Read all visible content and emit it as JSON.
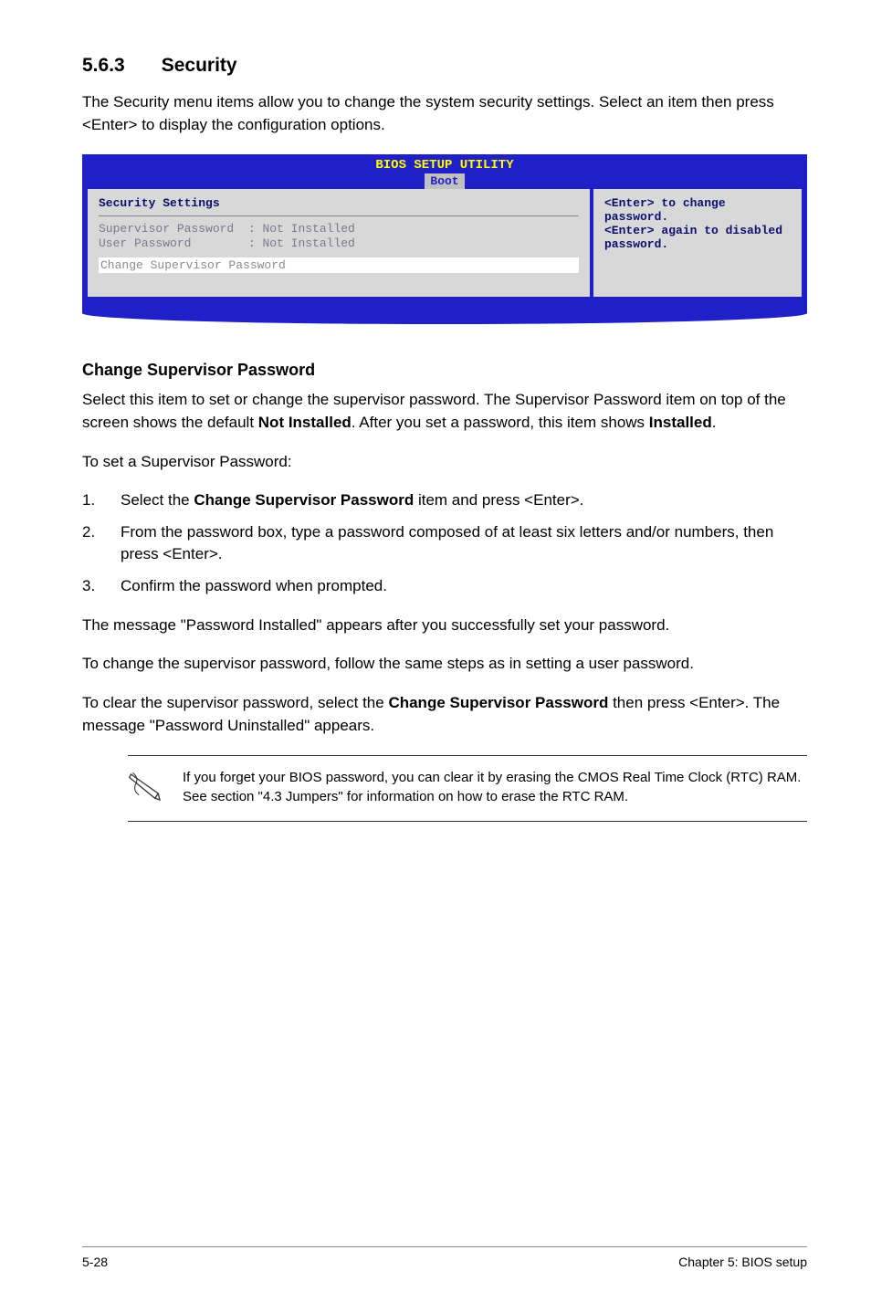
{
  "heading": {
    "number": "5.6.3",
    "title": "Security"
  },
  "intro": "The Security menu items allow you to change the system security settings. Select an item then press <Enter> to display the configuration options.",
  "bios": {
    "title": "BIOS SETUP UTILITY",
    "tab": "Boot",
    "left_heading": "Security Settings",
    "row1_label": "Supervisor Password",
    "row1_value": ": Not Installed",
    "row2_label": "User Password",
    "row2_value": ": Not Installed",
    "selected": "Change Supervisor Password",
    "right1": "<Enter> to change password.",
    "right2": "<Enter> again to disabled password."
  },
  "subheading": "Change Supervisor Password",
  "p1_a": "Select this item to set or change the supervisor password. The Supervisor Password item on top of the screen shows the default ",
  "p1_bold": "Not Installed",
  "p1_b": ". After you set a password, this item shows ",
  "p1_bold2": "Installed",
  "p1_c": ".",
  "p2": "To set a Supervisor Password:",
  "list": {
    "n1": "1.",
    "i1_a": "Select the ",
    "i1_bold": "Change Supervisor Password",
    "i1_b": " item and press <Enter>.",
    "n2": "2.",
    "i2": "From the password box, type a password composed of at least six letters and/or numbers, then press <Enter>.",
    "n3": "3.",
    "i3": "Confirm the password when prompted."
  },
  "p3": "The message \"Password Installed\" appears after you successfully set your password.",
  "p4": "To change the supervisor password, follow the same steps as in setting a user password.",
  "p5_a": "To clear the supervisor password, select the ",
  "p5_bold": "Change Supervisor Password",
  "p5_b": " then press <Enter>. The message \"Password Uninstalled\" appears.",
  "note": "If you forget your BIOS password, you can clear it by erasing the CMOS Real Time Clock (RTC) RAM. See section \"4.3 Jumpers\" for information on how to erase the RTC RAM.",
  "footer": {
    "left": "5-28",
    "right": "Chapter 5: BIOS setup"
  }
}
